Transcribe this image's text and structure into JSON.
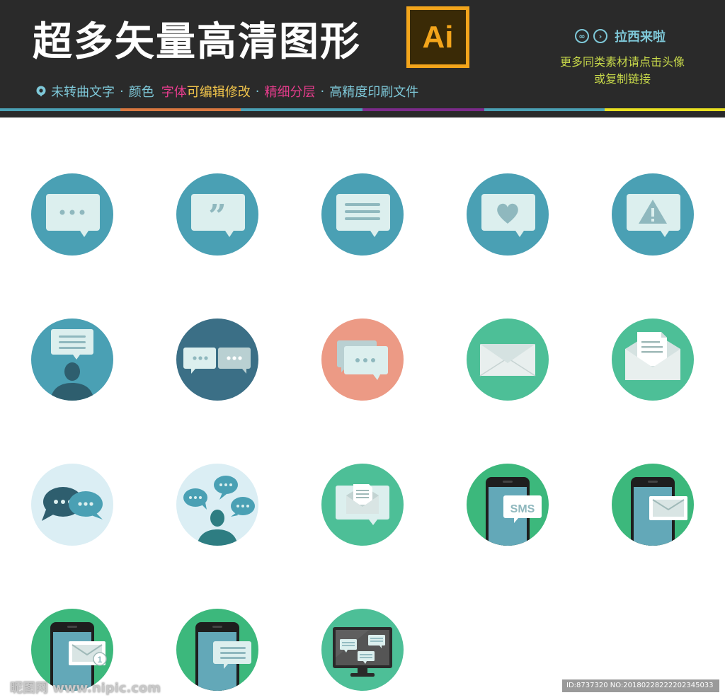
{
  "header": {
    "title": "超多矢量高清图形",
    "logo_text": "Ai",
    "features": {
      "part1": "未转曲文字",
      "part2": "颜色",
      "part3a": "字体",
      "part3b": "可编辑修改",
      "part4": "精细分层",
      "part5": "高精度印刷文件",
      "separator": "·"
    },
    "author_name": "拉西来啦",
    "more_line1": "更多同类素材请点击头像",
    "more_line2": "或复制链接"
  },
  "icons": [
    {
      "name": "chat-bubble-dots-icon"
    },
    {
      "name": "chat-bubble-quote-icon"
    },
    {
      "name": "chat-bubble-lines-icon"
    },
    {
      "name": "chat-bubble-heart-icon"
    },
    {
      "name": "chat-bubble-warning-icon"
    },
    {
      "name": "person-speech-bubble-icon"
    },
    {
      "name": "two-chat-bubbles-icon"
    },
    {
      "name": "overlapping-chat-bubbles-icon"
    },
    {
      "name": "envelope-closed-icon"
    },
    {
      "name": "envelope-open-letter-icon"
    },
    {
      "name": "chat-clouds-icon"
    },
    {
      "name": "person-many-bubbles-icon"
    },
    {
      "name": "bubble-envelope-icon"
    },
    {
      "name": "phone-sms-icon"
    },
    {
      "name": "phone-envelope-icon"
    },
    {
      "name": "phone-envelope-badge-icon"
    },
    {
      "name": "phone-message-icon"
    },
    {
      "name": "monitor-chat-icon"
    }
  ],
  "sms_label": "SMS",
  "badge_count": "1",
  "watermark": {
    "left": "昵图网 www.nipic.com",
    "right": "ID:8737320 NO:20180228222202345033"
  },
  "colors": {
    "banner": "#2a2a2a",
    "teal": "#4aa0b4",
    "dark_teal": "#3b6f86",
    "salmon": "#ec9a85",
    "green": "#4dbf97",
    "bright_green": "#3cb87c",
    "pale_blue": "#dbeef4"
  }
}
